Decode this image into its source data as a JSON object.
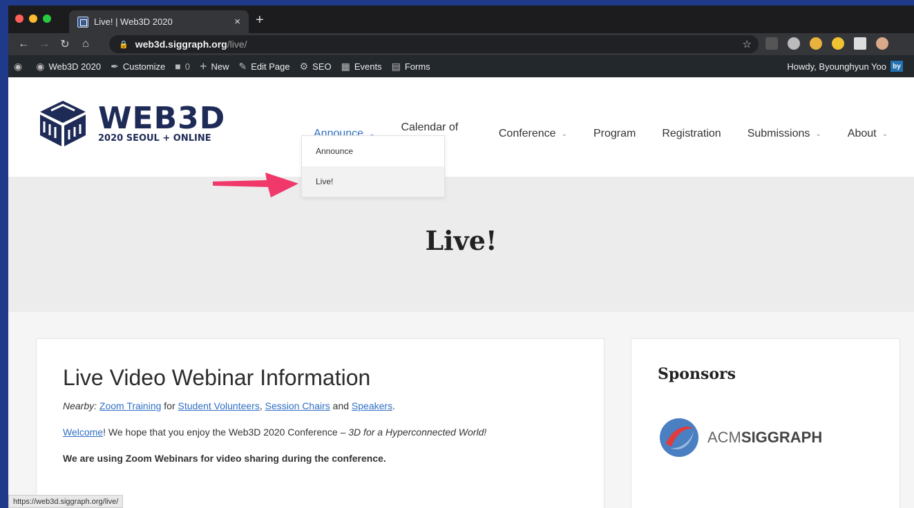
{
  "browser": {
    "tab_title": "Live! | Web3D 2020",
    "tab_close": "×",
    "new_tab": "+",
    "url_host": "web3d.siggraph.org",
    "url_path": "/live/",
    "status_url": "https://web3d.siggraph.org/live/"
  },
  "adminbar": {
    "site_name": "Web3D 2020",
    "customize": "Customize",
    "comments_count": "0",
    "new": "New",
    "edit_page": "Edit Page",
    "seo": "SEO",
    "events": "Events",
    "forms": "Forms",
    "howdy": "Howdy, Byounghyun Yoo",
    "avatar": "by"
  },
  "logo": {
    "title": "WEB3D",
    "subtitle": "2020 SEOUL + ONLINE"
  },
  "nav": {
    "announce": "Announce",
    "calendar": "Calendar of Events",
    "conference": "Conference",
    "program": "Program",
    "registration": "Registration",
    "submissions": "Submissions",
    "about": "About"
  },
  "dropdown": {
    "items": [
      "Announce",
      "Live!"
    ]
  },
  "hero": {
    "title": "Live!"
  },
  "main": {
    "heading": "Live Video Webinar Information",
    "nearby_label": "Nearby:",
    "zoom_training": "Zoom Training",
    "for": " for ",
    "student_volunteers": "Student Volunteers",
    "comma": ", ",
    "session_chairs": "Session Chairs",
    "and": " and ",
    "speakers": "Speakers",
    "period": ".",
    "welcome": "Welcome",
    "welcome_rest": "! We hope that you enjoy the Web3D 2020 Conference – ",
    "tagline": "3D for a Hyperconnected World!",
    "zoom_note": "We are using Zoom Webinars for video sharing during the conference."
  },
  "sidebar": {
    "heading": "Sponsors",
    "sponsor_prefix": "ACM",
    "sponsor_bold": "SIGGRAPH"
  },
  "colors": {
    "frame": "#1f3a8a",
    "accent": "#2f6fc3",
    "arrow": "#f0386b",
    "logo_navy": "#1f2b57"
  }
}
